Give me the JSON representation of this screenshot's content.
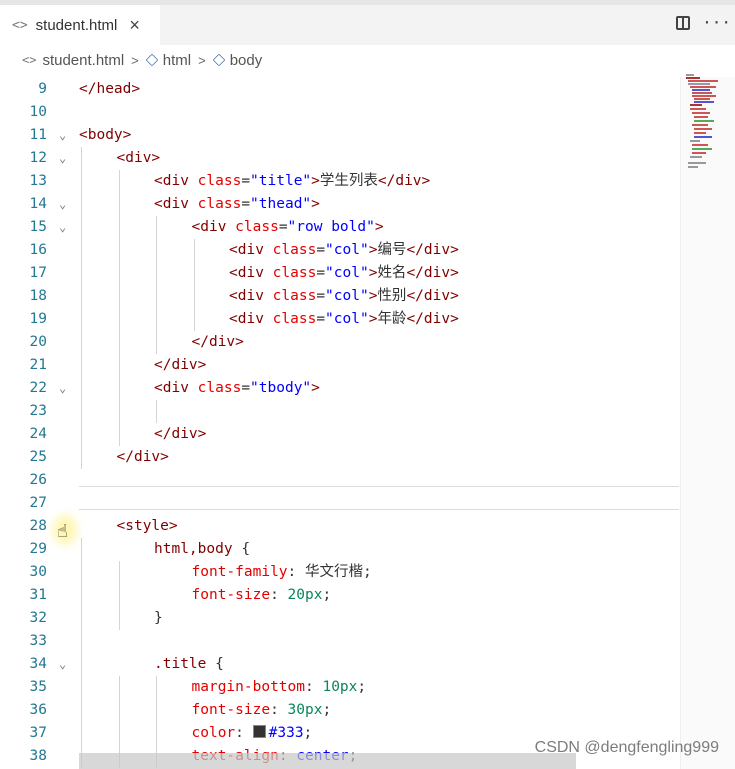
{
  "tab": {
    "filename": "student.html",
    "icon": "html-file-icon",
    "close": "×"
  },
  "tab_actions": {
    "more": "···"
  },
  "breadcrumb": {
    "file": "student.html",
    "sep": ">",
    "items": [
      "html",
      "body"
    ]
  },
  "lines": [
    {
      "n": "9",
      "fold": "",
      "indent": 0,
      "segs": [
        [
          "tag",
          "</head>"
        ]
      ]
    },
    {
      "n": "10",
      "fold": "",
      "indent": 0,
      "segs": []
    },
    {
      "n": "11",
      "fold": "⌄",
      "indent": 0,
      "segs": [
        [
          "tag",
          "<body>"
        ]
      ]
    },
    {
      "n": "12",
      "fold": "⌄",
      "indent": 1,
      "segs": [
        [
          "tag",
          "<div>"
        ]
      ]
    },
    {
      "n": "13",
      "fold": "",
      "indent": 2,
      "segs": [
        [
          "tag",
          "<div "
        ],
        [
          "attr",
          "class"
        ],
        [
          "plain",
          "="
        ],
        [
          "str",
          "\"title\""
        ],
        [
          "tag",
          ">"
        ],
        [
          "plain",
          "学生列表"
        ],
        [
          "tag",
          "</div>"
        ]
      ]
    },
    {
      "n": "14",
      "fold": "⌄",
      "indent": 2,
      "segs": [
        [
          "tag",
          "<div "
        ],
        [
          "attr",
          "class"
        ],
        [
          "plain",
          "="
        ],
        [
          "str",
          "\"thead\""
        ],
        [
          "tag",
          ">"
        ]
      ]
    },
    {
      "n": "15",
      "fold": "⌄",
      "indent": 3,
      "segs": [
        [
          "tag",
          "<div "
        ],
        [
          "attr",
          "class"
        ],
        [
          "plain",
          "="
        ],
        [
          "str",
          "\"row bold\""
        ],
        [
          "tag",
          ">"
        ]
      ]
    },
    {
      "n": "16",
      "fold": "",
      "indent": 4,
      "segs": [
        [
          "tag",
          "<div "
        ],
        [
          "attr",
          "class"
        ],
        [
          "plain",
          "="
        ],
        [
          "str",
          "\"col\""
        ],
        [
          "tag",
          ">"
        ],
        [
          "plain",
          "编号"
        ],
        [
          "tag",
          "</div>"
        ]
      ]
    },
    {
      "n": "17",
      "fold": "",
      "indent": 4,
      "segs": [
        [
          "tag",
          "<div "
        ],
        [
          "attr",
          "class"
        ],
        [
          "plain",
          "="
        ],
        [
          "str",
          "\"col\""
        ],
        [
          "tag",
          ">"
        ],
        [
          "plain",
          "姓名"
        ],
        [
          "tag",
          "</div>"
        ]
      ]
    },
    {
      "n": "18",
      "fold": "",
      "indent": 4,
      "segs": [
        [
          "tag",
          "<div "
        ],
        [
          "attr",
          "class"
        ],
        [
          "plain",
          "="
        ],
        [
          "str",
          "\"col\""
        ],
        [
          "tag",
          ">"
        ],
        [
          "plain",
          "性别"
        ],
        [
          "tag",
          "</div>"
        ]
      ]
    },
    {
      "n": "19",
      "fold": "",
      "indent": 4,
      "segs": [
        [
          "tag",
          "<div "
        ],
        [
          "attr",
          "class"
        ],
        [
          "plain",
          "="
        ],
        [
          "str",
          "\"col\""
        ],
        [
          "tag",
          ">"
        ],
        [
          "plain",
          "年龄"
        ],
        [
          "tag",
          "</div>"
        ]
      ]
    },
    {
      "n": "20",
      "fold": "",
      "indent": 3,
      "segs": [
        [
          "tag",
          "</div>"
        ]
      ]
    },
    {
      "n": "21",
      "fold": "",
      "indent": 2,
      "segs": [
        [
          "tag",
          "</div>"
        ]
      ]
    },
    {
      "n": "22",
      "fold": "⌄",
      "indent": 2,
      "segs": [
        [
          "tag",
          "<div "
        ],
        [
          "attr",
          "class"
        ],
        [
          "plain",
          "="
        ],
        [
          "str",
          "\"tbody\""
        ],
        [
          "tag",
          ">"
        ]
      ]
    },
    {
      "n": "23",
      "fold": "",
      "indent": 0,
      "segs": []
    },
    {
      "n": "24",
      "fold": "",
      "indent": 2,
      "segs": [
        [
          "tag",
          "</div>"
        ]
      ]
    },
    {
      "n": "25",
      "fold": "",
      "indent": 1,
      "segs": [
        [
          "tag",
          "</div>"
        ]
      ]
    },
    {
      "n": "26",
      "fold": "",
      "indent": 0,
      "segs": []
    },
    {
      "n": "27",
      "fold": "",
      "indent": 0,
      "segs": []
    },
    {
      "n": "28",
      "fold": "",
      "indent": 1,
      "segs": [
        [
          "tag",
          "<style>"
        ]
      ]
    },
    {
      "n": "29",
      "fold": "",
      "indent": 2,
      "segs": [
        [
          "sel",
          "html,body "
        ],
        [
          "plain",
          "{"
        ]
      ]
    },
    {
      "n": "30",
      "fold": "",
      "indent": 3,
      "segs": [
        [
          "prop",
          "font-family"
        ],
        [
          "plain",
          ": 华文行楷;"
        ]
      ]
    },
    {
      "n": "31",
      "fold": "",
      "indent": 3,
      "segs": [
        [
          "prop",
          "font-size"
        ],
        [
          "plain",
          ": "
        ],
        [
          "num",
          "20px"
        ],
        [
          "plain",
          ";"
        ]
      ]
    },
    {
      "n": "32",
      "fold": "",
      "indent": 2,
      "segs": [
        [
          "plain",
          "}"
        ]
      ]
    },
    {
      "n": "33",
      "fold": "",
      "indent": 0,
      "segs": []
    },
    {
      "n": "34",
      "fold": "⌄",
      "indent": 2,
      "segs": [
        [
          "sel",
          ".title "
        ],
        [
          "plain",
          "{"
        ]
      ]
    },
    {
      "n": "35",
      "fold": "",
      "indent": 3,
      "segs": [
        [
          "prop",
          "margin-bottom"
        ],
        [
          "plain",
          ": "
        ],
        [
          "num",
          "10px"
        ],
        [
          "plain",
          ";"
        ]
      ]
    },
    {
      "n": "36",
      "fold": "",
      "indent": 3,
      "segs": [
        [
          "prop",
          "font-size"
        ],
        [
          "plain",
          ": "
        ],
        [
          "num",
          "30px"
        ],
        [
          "plain",
          ";"
        ]
      ]
    },
    {
      "n": "37",
      "fold": "",
      "indent": 3,
      "segs": [
        [
          "prop",
          "color"
        ],
        [
          "plain",
          ": "
        ],
        [
          "swatch",
          ""
        ],
        [
          "str",
          "#333"
        ],
        [
          "plain",
          ";"
        ]
      ]
    },
    {
      "n": "38",
      "fold": "",
      "indent": 3,
      "segs": [
        [
          "prop",
          "text-align"
        ],
        [
          "plain",
          ": "
        ],
        [
          "str",
          "center"
        ],
        [
          "plain",
          ";"
        ]
      ]
    }
  ],
  "watermark": "CSDN @dengfengling999"
}
